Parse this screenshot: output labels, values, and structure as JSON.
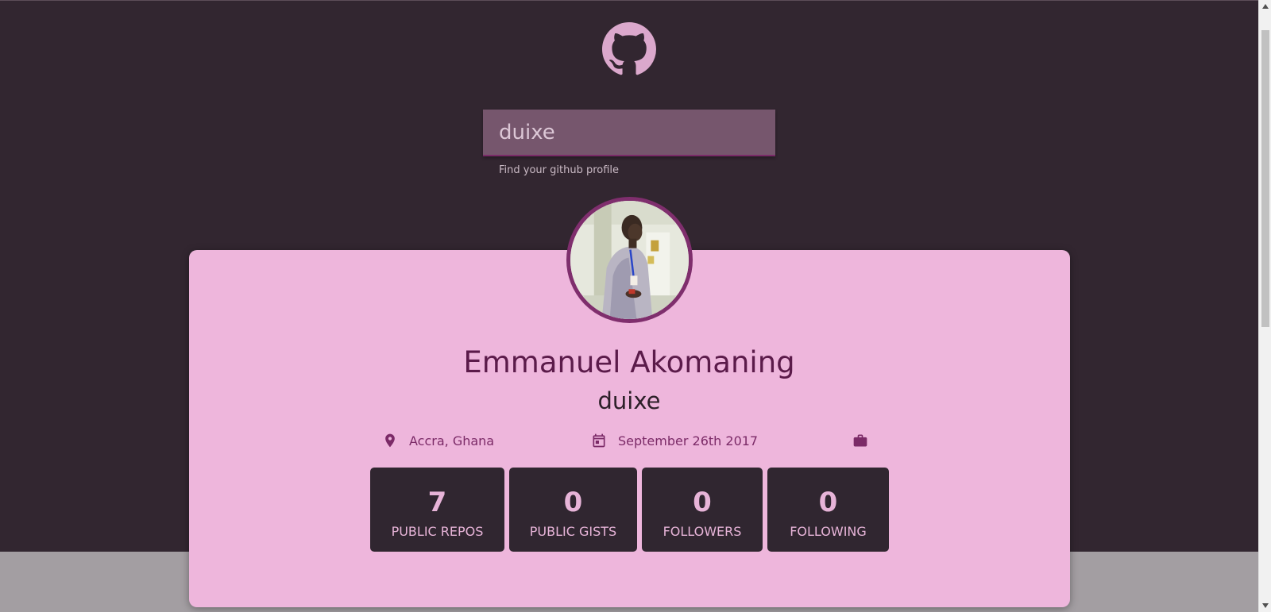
{
  "search": {
    "value": "duixe",
    "helper_text": "Find your github profile"
  },
  "profile": {
    "name": "Emmanuel Akomaning",
    "login": "duixe",
    "location": "Accra, Ghana",
    "joined": "September 26th 2017",
    "company": ""
  },
  "stats": [
    {
      "value": "7",
      "label": "PUBLIC REPOS"
    },
    {
      "value": "0",
      "label": "PUBLIC GISTS"
    },
    {
      "value": "0",
      "label": "FOLLOWERS"
    },
    {
      "value": "0",
      "label": "FOLLOWING"
    }
  ],
  "icons": {
    "logo": "github-octocat-icon",
    "location": "map-pin-icon",
    "date": "calendar-icon",
    "company": "briefcase-icon"
  },
  "colors": {
    "background": "#322630",
    "card": "#eeb6dc",
    "accent": "#7b2a67",
    "logo": "#dba8cc",
    "search_box": "#76566d",
    "stat_box": "#302630",
    "footer": "#a39ea2"
  }
}
